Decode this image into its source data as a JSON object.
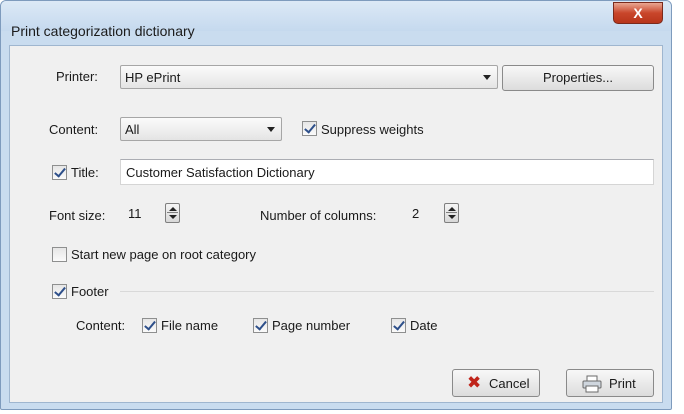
{
  "window": {
    "title": "Print categorization dictionary",
    "close_label": "X"
  },
  "printer": {
    "label": "Printer:",
    "value": "HP ePrint",
    "properties_label": "Properties..."
  },
  "content": {
    "label": "Content:",
    "value": "All"
  },
  "suppress_weights": {
    "label": "Suppress weights",
    "checked": true
  },
  "title_field": {
    "label": "Title:",
    "checked": true,
    "value": "Customer Satisfaction Dictionary"
  },
  "font_size": {
    "label": "Font size:",
    "value": "11"
  },
  "columns": {
    "label": "Number of columns:",
    "value": "2"
  },
  "new_page": {
    "label": "Start new page on root category",
    "checked": false
  },
  "footer": {
    "label": "Footer",
    "checked": true,
    "content_label": "Content:",
    "options": [
      {
        "label": "File name",
        "checked": true
      },
      {
        "label": "Page number",
        "checked": true
      },
      {
        "label": "Date",
        "checked": true
      }
    ]
  },
  "buttons": {
    "cancel": "Cancel",
    "print": "Print"
  },
  "colors": {
    "cancel_x": "#c0241a",
    "accent": "#2d4f8a"
  }
}
